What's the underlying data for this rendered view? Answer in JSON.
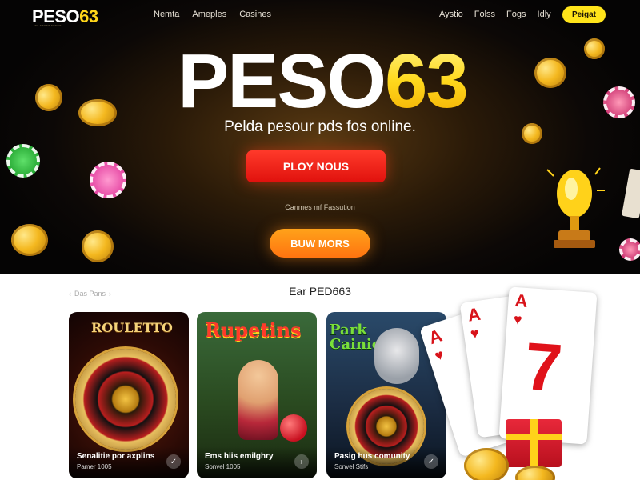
{
  "brand": {
    "logo_white": "PESO",
    "logo_yellow": "63"
  },
  "nav": {
    "left": [
      "Nemta",
      "Ameples",
      "Casines"
    ],
    "right": [
      "Aystio",
      "Folss",
      "Fogs",
      "Idly"
    ]
  },
  "header": {
    "register_label": "Peigat"
  },
  "hero": {
    "title_white": "PESO",
    "title_yellow": "63",
    "tagline": "Pelda pesour pds fos online.",
    "play_label": "PLOY NOUS",
    "note": "Canmes mf Fassution",
    "buy_label": "BUW MORS"
  },
  "section": {
    "crumbs": [
      "‹",
      "Das Pans",
      "›"
    ],
    "title": "Ear PED663"
  },
  "games": [
    {
      "title": "ROULETTO",
      "name": "Senalitie por axplins",
      "sub": "Pamer 1005",
      "icon": "check-icon"
    },
    {
      "title": "Rupetins",
      "name": "Ems hiis emilghry",
      "sub": "Sonvel 1005",
      "icon": "chevron-right-icon"
    },
    {
      "title": "Park Cainie",
      "name": "Pasig hus comunity",
      "sub": "Sonvel Stifs",
      "icon": "check-icon"
    }
  ],
  "deco_cards": [
    "A",
    "A",
    "A",
    "7"
  ],
  "colors": {
    "accent_yellow": "#ffd61a",
    "play_red": "#e0110d",
    "buy_orange": "#ff8a14",
    "hero_bg": "#0c0806"
  }
}
